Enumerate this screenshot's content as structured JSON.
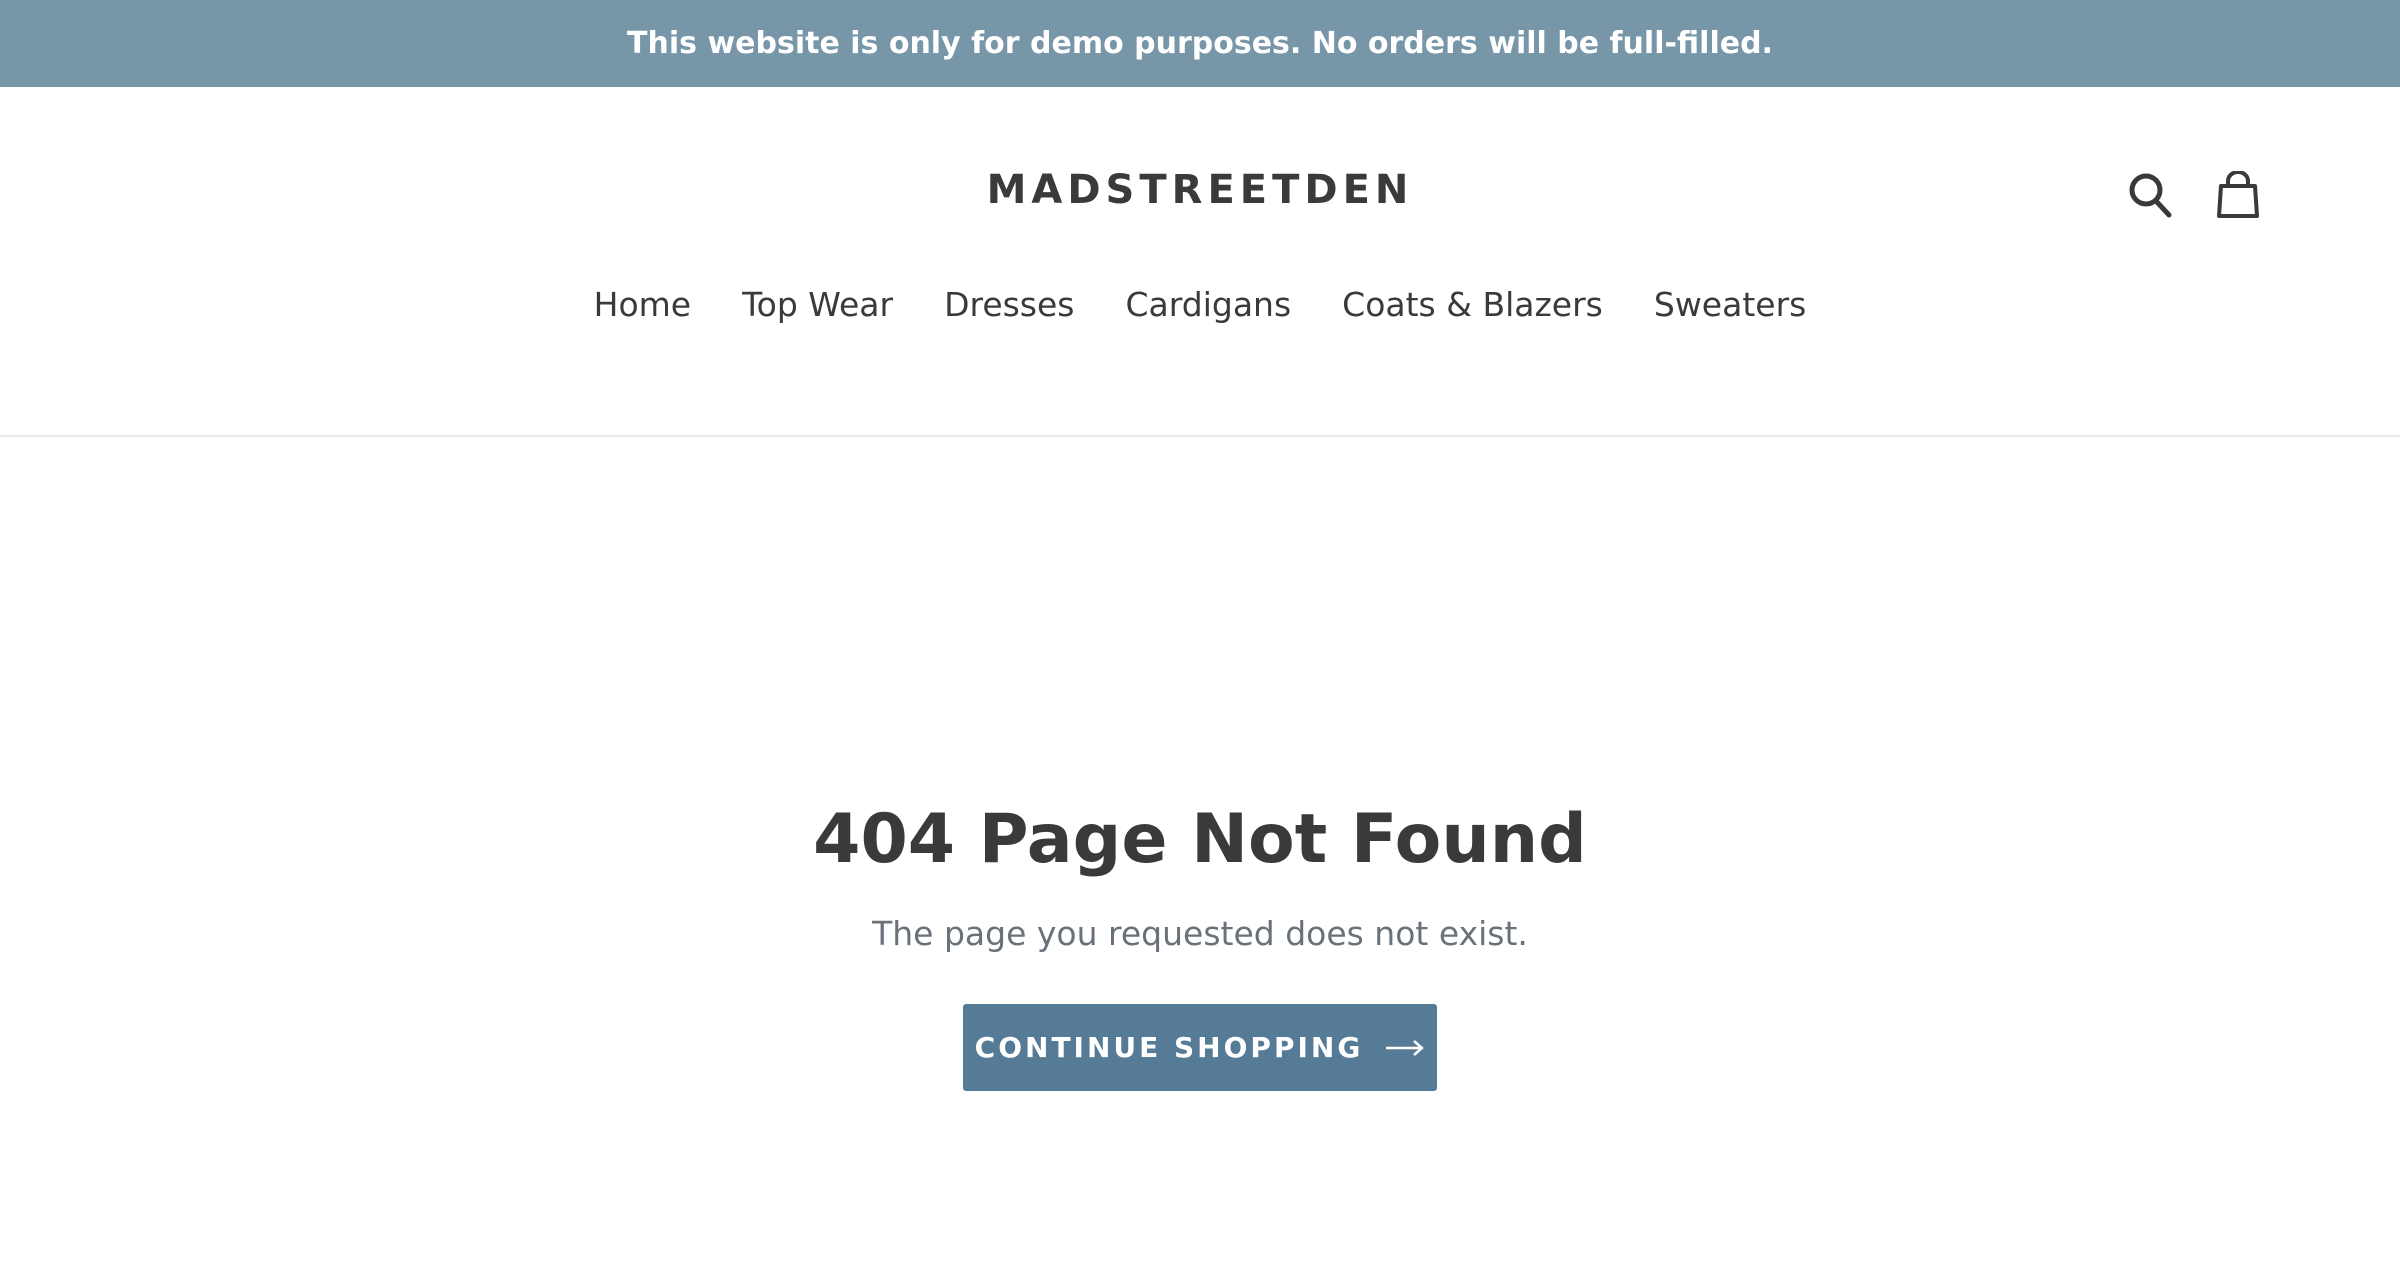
{
  "announcement": {
    "text": "This website is only for demo purposes. No orders will be full-filled."
  },
  "header": {
    "logo": "MADSTREETDEN",
    "icons": {
      "search": "search-icon",
      "cart": "cart-icon"
    }
  },
  "nav": {
    "items": [
      {
        "label": "Home"
      },
      {
        "label": "Top Wear"
      },
      {
        "label": "Dresses"
      },
      {
        "label": "Cardigans"
      },
      {
        "label": "Coats & Blazers"
      },
      {
        "label": "Sweaters"
      }
    ]
  },
  "main": {
    "title": "404 Page Not Found",
    "subtitle": "The page you requested does not exist.",
    "button_label": "CONTINUE SHOPPING",
    "button_icon": "arrow-right-icon"
  },
  "colors": {
    "announcement_bg": "#7796a8",
    "button_bg": "#557b97",
    "text": "#3a3a3a",
    "muted_text": "#69727b"
  }
}
